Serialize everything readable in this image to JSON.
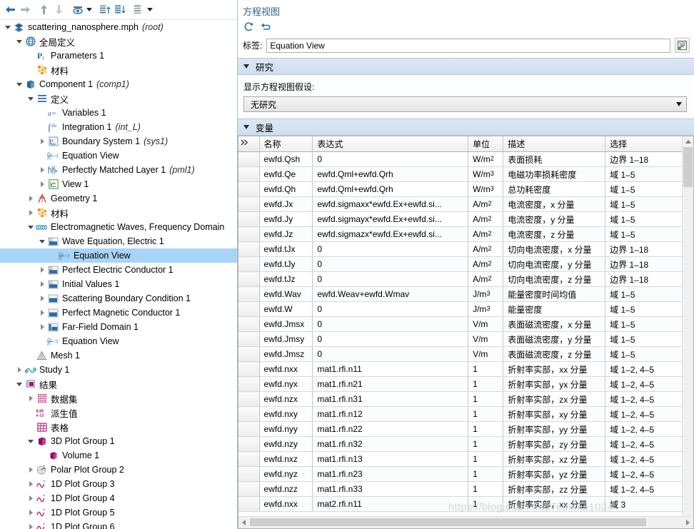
{
  "tree_toolbar": {
    "buttons": [
      {
        "name": "back-arrow-icon",
        "label": "←"
      },
      {
        "name": "forward-arrow-icon",
        "label": "→"
      },
      {
        "name": "move-up-icon",
        "label": "↑"
      },
      {
        "name": "move-down-icon",
        "label": "↓"
      },
      {
        "name": "show-hide-icon",
        "label": "eye"
      },
      {
        "name": "collapse-expand-up-icon",
        "label": "list-up"
      },
      {
        "name": "expand-down-icon",
        "label": "list-down"
      },
      {
        "name": "list-options-icon",
        "label": "list"
      }
    ]
  },
  "tree": {
    "nodes": [
      {
        "depth": 0,
        "twist": "down",
        "icon": "model-root-icon",
        "label": "scattering_nanosphere.mph",
        "italic": "(root)",
        "selected": false
      },
      {
        "depth": 1,
        "twist": "down",
        "icon": "globe-icon",
        "label": "全局定义",
        "italic": "",
        "selected": false
      },
      {
        "depth": 2,
        "twist": "none",
        "icon": "parameters-icon",
        "label": "Parameters 1",
        "italic": "",
        "selected": false
      },
      {
        "depth": 2,
        "twist": "none",
        "icon": "materials-icon",
        "label": "材料",
        "italic": "",
        "selected": false
      },
      {
        "depth": 1,
        "twist": "down",
        "icon": "component-icon",
        "label": "Component 1",
        "italic": "(comp1)",
        "selected": false
      },
      {
        "depth": 2,
        "twist": "down",
        "icon": "definitions-icon",
        "label": "定义",
        "italic": "",
        "selected": false
      },
      {
        "depth": 3,
        "twist": "none",
        "icon": "variables-icon",
        "label": "Variables 1",
        "italic": "",
        "selected": false
      },
      {
        "depth": 3,
        "twist": "none",
        "icon": "integration-icon",
        "label": "Integration 1",
        "italic": "(int_L)",
        "selected": false
      },
      {
        "depth": 3,
        "twist": "right",
        "icon": "boundary-system-icon",
        "label": "Boundary System 1",
        "italic": "(sys1)",
        "selected": false
      },
      {
        "depth": 3,
        "twist": "none",
        "icon": "equation-view-icon",
        "label": "Equation View",
        "italic": "",
        "selected": false
      },
      {
        "depth": 3,
        "twist": "right",
        "icon": "pml-icon",
        "label": "Perfectly Matched Layer 1",
        "italic": "(pml1)",
        "selected": false
      },
      {
        "depth": 3,
        "twist": "right",
        "icon": "view-icon",
        "label": "View 1",
        "italic": "",
        "selected": false
      },
      {
        "depth": 2,
        "twist": "right",
        "icon": "geometry-icon",
        "label": "Geometry 1",
        "italic": "",
        "selected": false
      },
      {
        "depth": 2,
        "twist": "right",
        "icon": "materials-icon",
        "label": "材料",
        "italic": "",
        "selected": false
      },
      {
        "depth": 2,
        "twist": "down",
        "icon": "physics-emw-icon",
        "label": "Electromagnetic Waves, Frequency Domain",
        "italic": "",
        "selected": false
      },
      {
        "depth": 3,
        "twist": "down",
        "icon": "domain-feature-icon",
        "label": "Wave Equation, Electric 1",
        "italic": "",
        "selected": false
      },
      {
        "depth": 4,
        "twist": "none",
        "icon": "equation-view-icon",
        "label": "Equation View",
        "italic": "",
        "selected": true
      },
      {
        "depth": 3,
        "twist": "right",
        "icon": "domain-feature-icon",
        "label": "Perfect Electric Conductor 1",
        "italic": "",
        "selected": false
      },
      {
        "depth": 3,
        "twist": "right",
        "icon": "domain-feature-icon",
        "label": "Initial Values 1",
        "italic": "",
        "selected": false
      },
      {
        "depth": 3,
        "twist": "right",
        "icon": "boundary-feature-icon",
        "label": "Scattering Boundary Condition 1",
        "italic": "",
        "selected": false
      },
      {
        "depth": 3,
        "twist": "right",
        "icon": "boundary-feature-icon",
        "label": "Perfect Magnetic Conductor 1",
        "italic": "",
        "selected": false
      },
      {
        "depth": 3,
        "twist": "right",
        "icon": "farfield-icon",
        "label": "Far-Field Domain 1",
        "italic": "",
        "selected": false
      },
      {
        "depth": 3,
        "twist": "none",
        "icon": "equation-view-icon",
        "label": "Equation View",
        "italic": "",
        "selected": false
      },
      {
        "depth": 2,
        "twist": "none",
        "icon": "mesh-icon",
        "label": "Mesh 1",
        "italic": "",
        "selected": false
      },
      {
        "depth": 1,
        "twist": "right",
        "icon": "study-icon",
        "label": "Study 1",
        "italic": "",
        "selected": false
      },
      {
        "depth": 1,
        "twist": "down",
        "icon": "results-icon",
        "label": "结果",
        "italic": "",
        "selected": false
      },
      {
        "depth": 2,
        "twist": "right",
        "icon": "datasets-icon",
        "label": "数据集",
        "italic": "",
        "selected": false
      },
      {
        "depth": 2,
        "twist": "none",
        "icon": "derived-values-icon",
        "label": "派生值",
        "italic": "",
        "selected": false
      },
      {
        "depth": 2,
        "twist": "none",
        "icon": "tables-icon",
        "label": "表格",
        "italic": "",
        "selected": false
      },
      {
        "depth": 2,
        "twist": "down",
        "icon": "plot3d-icon",
        "label": "3D Plot Group 1",
        "italic": "",
        "selected": false
      },
      {
        "depth": 3,
        "twist": "none",
        "icon": "volume-icon",
        "label": "Volume 1",
        "italic": "",
        "selected": false
      },
      {
        "depth": 2,
        "twist": "right",
        "icon": "polar-plot-icon",
        "label": "Polar Plot Group 2",
        "italic": "",
        "selected": false
      },
      {
        "depth": 2,
        "twist": "right",
        "icon": "plot1d-icon",
        "label": "1D Plot Group 3",
        "italic": "",
        "selected": false
      },
      {
        "depth": 2,
        "twist": "right",
        "icon": "plot1d-icon",
        "label": "1D Plot Group 4",
        "italic": "",
        "selected": false
      },
      {
        "depth": 2,
        "twist": "right",
        "icon": "plot1d-icon",
        "label": "1D Plot Group 5",
        "italic": "",
        "selected": false
      },
      {
        "depth": 2,
        "twist": "right",
        "icon": "plot1d-icon",
        "label": "1D Plot Group 6",
        "italic": "",
        "selected": false
      }
    ]
  },
  "settings": {
    "title": "方程视图",
    "refresh_icon": "refresh-icon",
    "reset_icon": "undo-reset-icon",
    "label_caption": "标签:",
    "label_value": "Equation View",
    "label_button_icon": "rename-note-icon",
    "study_section": {
      "header": "研究",
      "field_label": "显示方程视图假设:",
      "combo_value": "无研究"
    },
    "variables_section": {
      "header": "变量"
    }
  },
  "table": {
    "columns": [
      "名称",
      "表达式",
      "单位",
      "描述",
      "选择"
    ],
    "corner_icon": "expand-columns-icon",
    "rows": [
      {
        "name": "ewfd.Qsh",
        "expr": "0",
        "unit": "W/m²",
        "desc": "表面损耗",
        "sel": "边界 1–18"
      },
      {
        "name": "ewfd.Qe",
        "expr": "ewfd.Qml+ewfd.Qrh",
        "unit": "W/m³",
        "desc": "电磁功率损耗密度",
        "sel": "域 1–5"
      },
      {
        "name": "ewfd.Qh",
        "expr": "ewfd.Qml+ewfd.Qrh",
        "unit": "W/m³",
        "desc": "总功耗密度",
        "sel": "域 1–5"
      },
      {
        "name": "ewfd.Jx",
        "expr": "ewfd.sigmaxx*ewfd.Ex+ewfd.si...",
        "unit": "A/m²",
        "desc": "电流密度，x 分量",
        "sel": "域 1–5"
      },
      {
        "name": "ewfd.Jy",
        "expr": "ewfd.sigmayx*ewfd.Ex+ewfd.si...",
        "unit": "A/m²",
        "desc": "电流密度，y 分量",
        "sel": "域 1–5"
      },
      {
        "name": "ewfd.Jz",
        "expr": "ewfd.sigmazx*ewfd.Ex+ewfd.si...",
        "unit": "A/m²",
        "desc": "电流密度，z 分量",
        "sel": "域 1–5"
      },
      {
        "name": "ewfd.tJx",
        "expr": "0",
        "unit": "A/m²",
        "desc": "切向电流密度，x 分量",
        "sel": "边界 1–18"
      },
      {
        "name": "ewfd.tJy",
        "expr": "0",
        "unit": "A/m²",
        "desc": "切向电流密度，y 分量",
        "sel": "边界 1–18"
      },
      {
        "name": "ewfd.tJz",
        "expr": "0",
        "unit": "A/m²",
        "desc": "切向电流密度，z 分量",
        "sel": "边界 1–18"
      },
      {
        "name": "ewfd.Wav",
        "expr": "ewfd.Weav+ewfd.Wmav",
        "unit": "J/m³",
        "desc": "能量密度时间均值",
        "sel": "域 1–5"
      },
      {
        "name": "ewfd.W",
        "expr": "0",
        "unit": "J/m³",
        "desc": "能量密度",
        "sel": "域 1–5"
      },
      {
        "name": "ewfd.Jmsx",
        "expr": "0",
        "unit": "V/m",
        "desc": "表面磁流密度，x 分量",
        "sel": "域 1–5"
      },
      {
        "name": "ewfd.Jmsy",
        "expr": "0",
        "unit": "V/m",
        "desc": "表面磁流密度，y 分量",
        "sel": "域 1–5"
      },
      {
        "name": "ewfd.Jmsz",
        "expr": "0",
        "unit": "V/m",
        "desc": "表面磁流密度，z 分量",
        "sel": "域 1–5"
      },
      {
        "name": "ewfd.nxx",
        "expr": "mat1.rfi.n11",
        "unit": "1",
        "desc": "折射率实部，xx 分量",
        "sel": "域 1–2, 4–5"
      },
      {
        "name": "ewfd.nyx",
        "expr": "mat1.rfi.n21",
        "unit": "1",
        "desc": "折射率实部，yx 分量",
        "sel": "域 1–2, 4–5"
      },
      {
        "name": "ewfd.nzx",
        "expr": "mat1.rfi.n31",
        "unit": "1",
        "desc": "折射率实部，zx 分量",
        "sel": "域 1–2, 4–5"
      },
      {
        "name": "ewfd.nxy",
        "expr": "mat1.rfi.n12",
        "unit": "1",
        "desc": "折射率实部，xy 分量",
        "sel": "域 1–2, 4–5"
      },
      {
        "name": "ewfd.nyy",
        "expr": "mat1.rfi.n22",
        "unit": "1",
        "desc": "折射率实部，yy 分量",
        "sel": "域 1–2, 4–5"
      },
      {
        "name": "ewfd.nzy",
        "expr": "mat1.rfi.n32",
        "unit": "1",
        "desc": "折射率实部，zy 分量",
        "sel": "域 1–2, 4–5"
      },
      {
        "name": "ewfd.nxz",
        "expr": "mat1.rfi.n13",
        "unit": "1",
        "desc": "折射率实部，xz 分量",
        "sel": "域 1–2, 4–5"
      },
      {
        "name": "ewfd.nyz",
        "expr": "mat1.rfi.n23",
        "unit": "1",
        "desc": "折射率实部，yz 分量",
        "sel": "域 1–2, 4–5"
      },
      {
        "name": "ewfd.nzz",
        "expr": "mat1.rfi.n33",
        "unit": "1",
        "desc": "折射率实部，zz 分量",
        "sel": "域 1–2, 4–5"
      },
      {
        "name": "ewfd.nxx",
        "expr": "mat2.rfi.n11",
        "unit": "1",
        "desc": "折射率实部，xx 分量",
        "sel": "域 3"
      }
    ]
  },
  "watermark": "https://blog.csdn.net/Temmie1024",
  "colors": {
    "selection_blue": "#a8d4f7",
    "section_header": "#cfdeee",
    "title_blue": "#35628f",
    "magenta": "#b01070",
    "orange": "#f39700",
    "steel_blue": "#2b6ca3"
  }
}
